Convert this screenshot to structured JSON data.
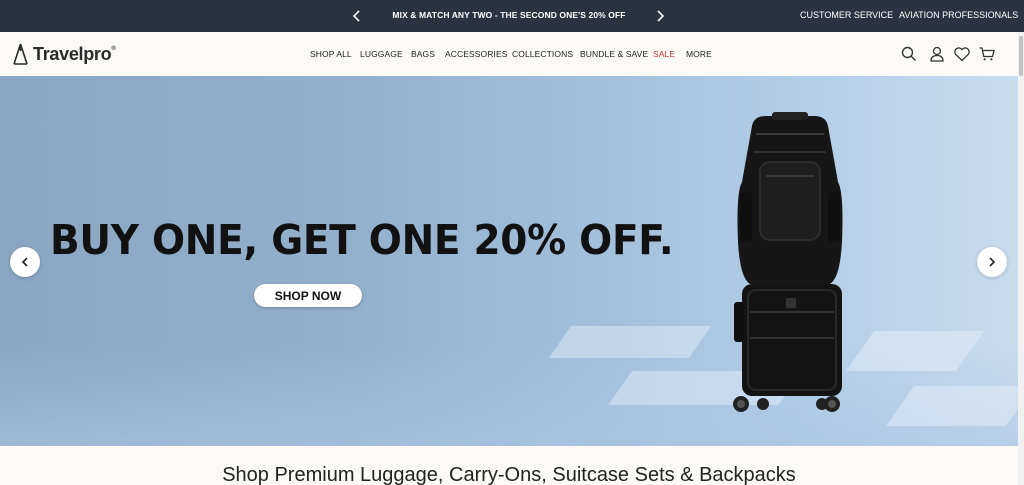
{
  "promo": {
    "message": "MIX & MATCH ANY TWO - THE SECOND ONE'S 20% OFF",
    "prev_icon": "chevron-left-icon",
    "next_icon": "chevron-right-icon",
    "customer_service": "CUSTOMER SERVICE",
    "aviation_professionals": "AVIATION PROFESSIONALS",
    "background": "#2c3340"
  },
  "header": {
    "logo_text": "Travelpro",
    "logo_mark": "®",
    "nav": [
      "SHOP ALL",
      "LUGGAGE",
      "BAGS",
      "ACCESSORIES",
      "COLLECTIONS",
      "BUNDLE & SAVE",
      "SALE",
      "MORE"
    ],
    "sale_color": "#c8302f",
    "icons": [
      "search-icon",
      "account-icon",
      "wishlist-heart-icon",
      "cart-icon"
    ]
  },
  "hero": {
    "headline": "BUY ONE, GET ONE 20% OFF.",
    "cta": "SHOP NOW",
    "prev_icon": "chevron-left-icon",
    "next_icon": "chevron-right-icon",
    "image": "black-carry-on-suitcase-with-backpack"
  },
  "section": {
    "title": "Shop Premium Luggage, Carry-Ons, Suitcase Sets & Backpacks"
  }
}
